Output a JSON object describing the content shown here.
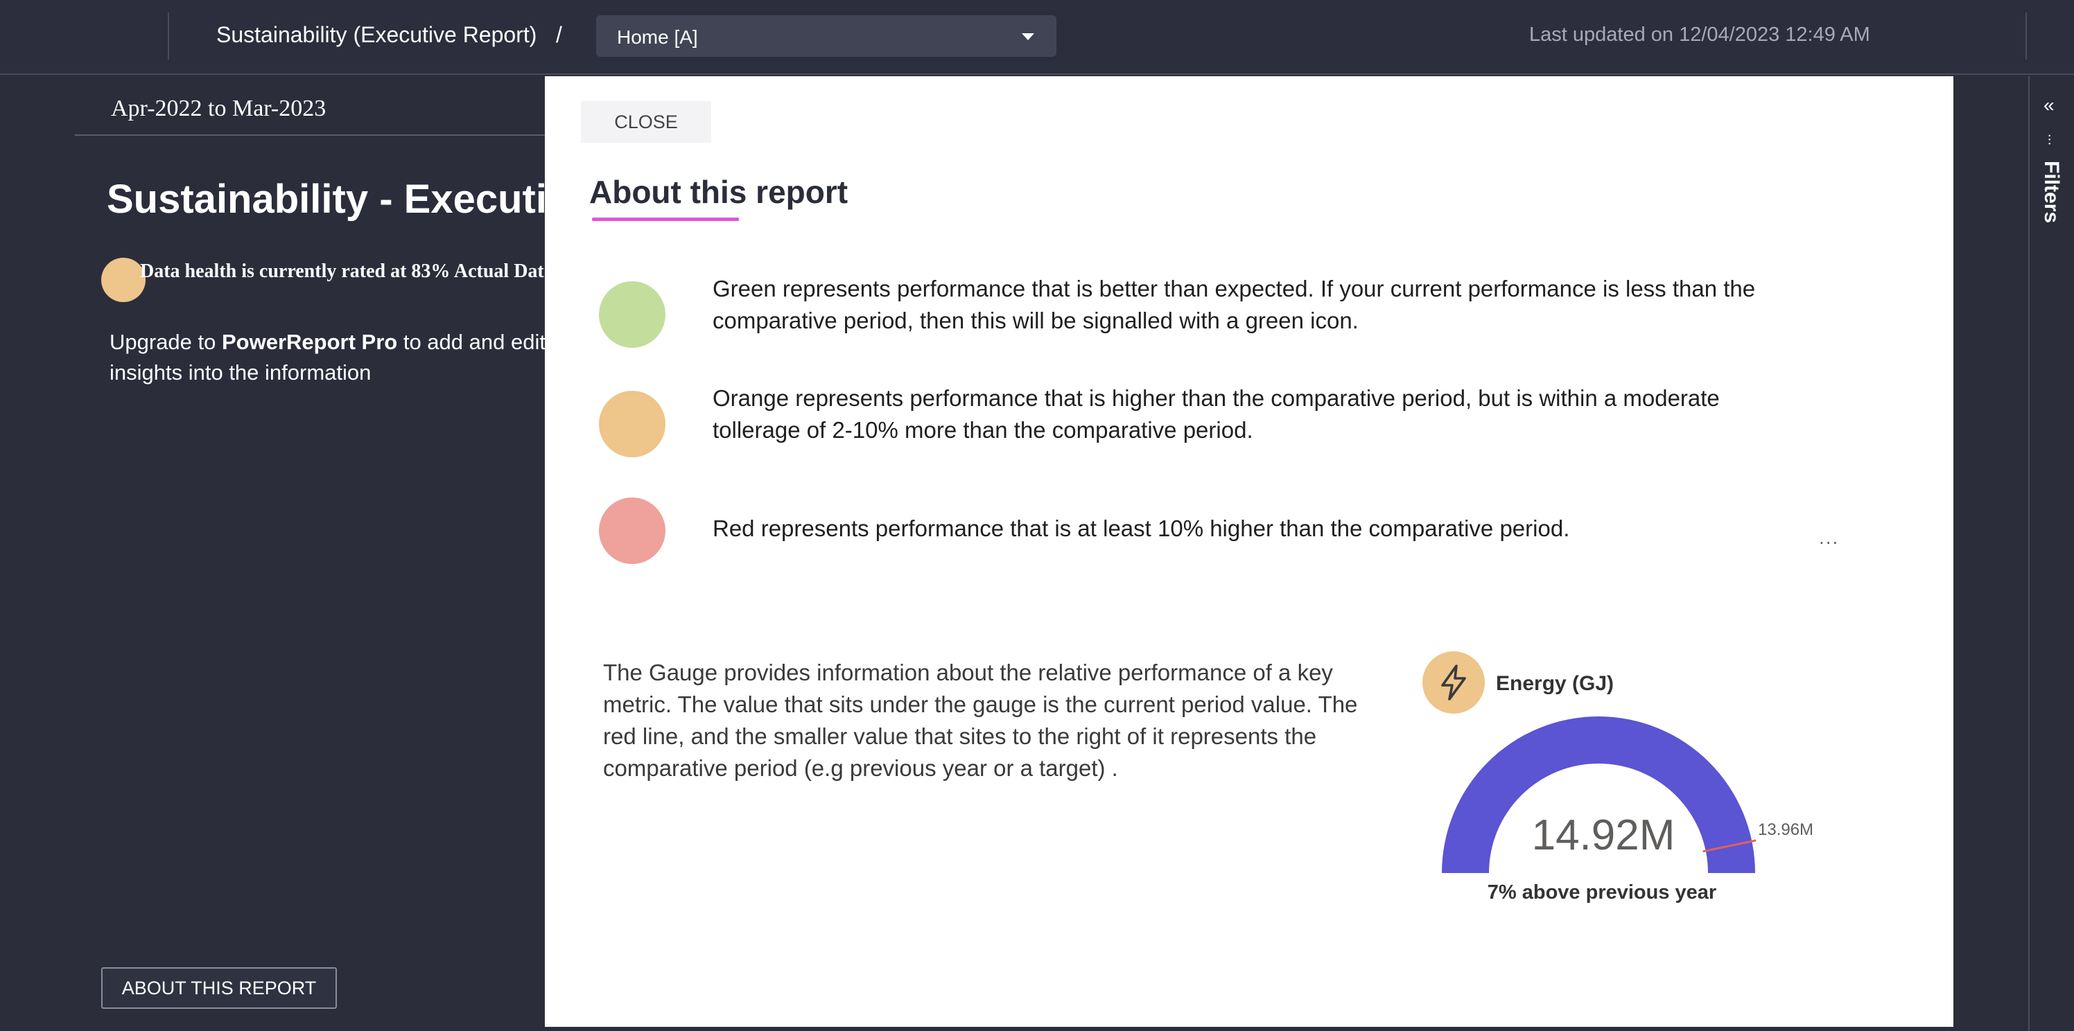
{
  "topbar": {
    "report_title": "Sustainability (Executive Report)",
    "breadcrumb_separator": "/",
    "page_select_value": "Home [A]",
    "last_updated": "Last updated on 12/04/2023 12:49 AM"
  },
  "report": {
    "date_range": "Apr-2022 to Mar-2023",
    "heading": "Sustainability - Executiv",
    "health_text": "Data health is currently rated at 83% Actual Dat",
    "upgrade_prefix": "Upgrade to ",
    "upgrade_product": "PowerReport Pro",
    "upgrade_suffix": " to add and edit commentary and insights into the information",
    "about_button": "ABOUT THIS REPORT"
  },
  "filters": {
    "label": "Filters",
    "collapse_icon": "double-chevron-left-icon",
    "filter_icon": "filter-icon"
  },
  "modal": {
    "close_label": "CLOSE",
    "title": "About this report",
    "legend": [
      {
        "color": "#c3de9c",
        "text": "Green represents performance that is better than expected.  If your current performance is less than the comparative period, then this will be signalled with a green icon."
      },
      {
        "color": "#eec58a",
        "text": "Orange represents performance that is higher than the comparative period, but is within a moderate tollerage of 2-10% more than the comparative period."
      },
      {
        "color": "#efa29c",
        "text": "Red represents performance that is at least 10% higher than the comparative period."
      }
    ],
    "more_options": "...",
    "gauge_description": "The Gauge provides information about the relative performance of a key metric.  The value that sits under the gauge is the current period value.  The red line, and the smaller value that sites to the right of it represents the comparative period (e.g previous year or a target) .",
    "gauge": {
      "icon": "lightning-icon",
      "title": "Energy (GJ)",
      "value": "14.92M",
      "target": "13.96M",
      "subtitle": "7% above previous year",
      "fill_color": "#5b54d3",
      "target_color": "#e0605a",
      "target_fraction": 0.935
    }
  }
}
